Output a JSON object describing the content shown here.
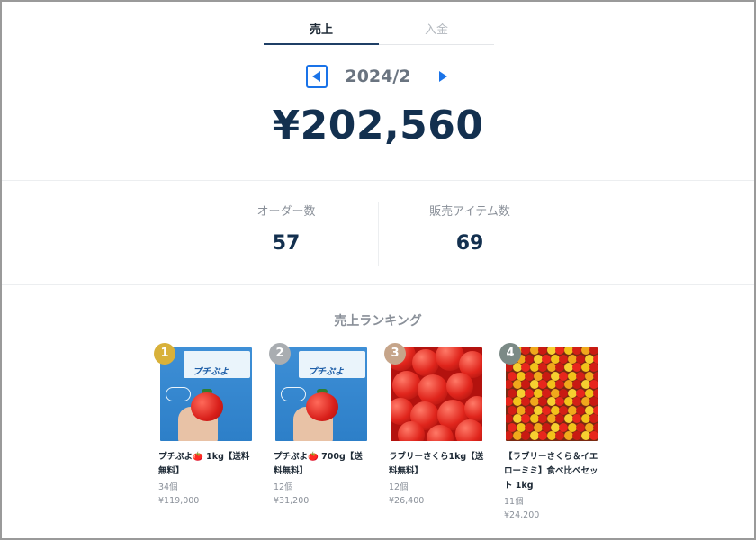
{
  "tabs": [
    {
      "label": "売上",
      "active": true
    },
    {
      "label": "入金",
      "active": false
    }
  ],
  "month": {
    "label": "2024/2",
    "prev_icon": "triangle-left-icon",
    "next_icon": "triangle-right-icon"
  },
  "total": "¥202,560",
  "stats": [
    {
      "label": "オーダー数",
      "value": "57"
    },
    {
      "label": "販売アイテム数",
      "value": "69"
    }
  ],
  "ranking": {
    "title": "売上ランキング",
    "items": [
      {
        "rank": "1",
        "badge_color": "#d8b13a",
        "title": "プチぷよ🍅 1kg【送料無料】",
        "qty": "34個",
        "amount": "¥119,000",
        "image": "petit-puyo-blue",
        "sign_text": "プチぷよ"
      },
      {
        "rank": "2",
        "badge_color": "#a9adb1",
        "title": "プチぷよ🍅 700g【送料無料】",
        "qty": "12個",
        "amount": "¥31,200",
        "image": "petit-puyo-blue",
        "sign_text": "プチぷよ"
      },
      {
        "rank": "3",
        "badge_color": "#c6a58a",
        "title": "ラブリーさくら1kg【送料無料】",
        "qty": "12個",
        "amount": "¥26,400",
        "image": "red-tomatoes"
      },
      {
        "rank": "4",
        "badge_color": "#7b8a86",
        "title": "【ラブリーさくら＆イエローミミ】食べ比べセット 1kg",
        "qty": "11個",
        "amount": "¥24,200",
        "image": "mixed-tomatoes"
      }
    ]
  },
  "colors": {
    "accent": "#1a73e8",
    "navy": "#13304f"
  }
}
